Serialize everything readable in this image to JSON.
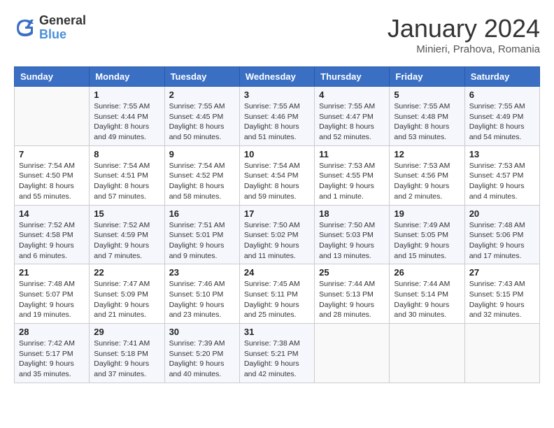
{
  "header": {
    "logo_general": "General",
    "logo_blue": "Blue",
    "title": "January 2024",
    "subtitle": "Minieri, Prahova, Romania"
  },
  "weekdays": [
    "Sunday",
    "Monday",
    "Tuesday",
    "Wednesday",
    "Thursday",
    "Friday",
    "Saturday"
  ],
  "weeks": [
    [
      {
        "day": "",
        "info": ""
      },
      {
        "day": "1",
        "info": "Sunrise: 7:55 AM\nSunset: 4:44 PM\nDaylight: 8 hours\nand 49 minutes."
      },
      {
        "day": "2",
        "info": "Sunrise: 7:55 AM\nSunset: 4:45 PM\nDaylight: 8 hours\nand 50 minutes."
      },
      {
        "day": "3",
        "info": "Sunrise: 7:55 AM\nSunset: 4:46 PM\nDaylight: 8 hours\nand 51 minutes."
      },
      {
        "day": "4",
        "info": "Sunrise: 7:55 AM\nSunset: 4:47 PM\nDaylight: 8 hours\nand 52 minutes."
      },
      {
        "day": "5",
        "info": "Sunrise: 7:55 AM\nSunset: 4:48 PM\nDaylight: 8 hours\nand 53 minutes."
      },
      {
        "day": "6",
        "info": "Sunrise: 7:55 AM\nSunset: 4:49 PM\nDaylight: 8 hours\nand 54 minutes."
      }
    ],
    [
      {
        "day": "7",
        "info": "Sunrise: 7:54 AM\nSunset: 4:50 PM\nDaylight: 8 hours\nand 55 minutes."
      },
      {
        "day": "8",
        "info": "Sunrise: 7:54 AM\nSunset: 4:51 PM\nDaylight: 8 hours\nand 57 minutes."
      },
      {
        "day": "9",
        "info": "Sunrise: 7:54 AM\nSunset: 4:52 PM\nDaylight: 8 hours\nand 58 minutes."
      },
      {
        "day": "10",
        "info": "Sunrise: 7:54 AM\nSunset: 4:54 PM\nDaylight: 8 hours\nand 59 minutes."
      },
      {
        "day": "11",
        "info": "Sunrise: 7:53 AM\nSunset: 4:55 PM\nDaylight: 9 hours\nand 1 minute."
      },
      {
        "day": "12",
        "info": "Sunrise: 7:53 AM\nSunset: 4:56 PM\nDaylight: 9 hours\nand 2 minutes."
      },
      {
        "day": "13",
        "info": "Sunrise: 7:53 AM\nSunset: 4:57 PM\nDaylight: 9 hours\nand 4 minutes."
      }
    ],
    [
      {
        "day": "14",
        "info": "Sunrise: 7:52 AM\nSunset: 4:58 PM\nDaylight: 9 hours\nand 6 minutes."
      },
      {
        "day": "15",
        "info": "Sunrise: 7:52 AM\nSunset: 4:59 PM\nDaylight: 9 hours\nand 7 minutes."
      },
      {
        "day": "16",
        "info": "Sunrise: 7:51 AM\nSunset: 5:01 PM\nDaylight: 9 hours\nand 9 minutes."
      },
      {
        "day": "17",
        "info": "Sunrise: 7:50 AM\nSunset: 5:02 PM\nDaylight: 9 hours\nand 11 minutes."
      },
      {
        "day": "18",
        "info": "Sunrise: 7:50 AM\nSunset: 5:03 PM\nDaylight: 9 hours\nand 13 minutes."
      },
      {
        "day": "19",
        "info": "Sunrise: 7:49 AM\nSunset: 5:05 PM\nDaylight: 9 hours\nand 15 minutes."
      },
      {
        "day": "20",
        "info": "Sunrise: 7:48 AM\nSunset: 5:06 PM\nDaylight: 9 hours\nand 17 minutes."
      }
    ],
    [
      {
        "day": "21",
        "info": "Sunrise: 7:48 AM\nSunset: 5:07 PM\nDaylight: 9 hours\nand 19 minutes."
      },
      {
        "day": "22",
        "info": "Sunrise: 7:47 AM\nSunset: 5:09 PM\nDaylight: 9 hours\nand 21 minutes."
      },
      {
        "day": "23",
        "info": "Sunrise: 7:46 AM\nSunset: 5:10 PM\nDaylight: 9 hours\nand 23 minutes."
      },
      {
        "day": "24",
        "info": "Sunrise: 7:45 AM\nSunset: 5:11 PM\nDaylight: 9 hours\nand 25 minutes."
      },
      {
        "day": "25",
        "info": "Sunrise: 7:44 AM\nSunset: 5:13 PM\nDaylight: 9 hours\nand 28 minutes."
      },
      {
        "day": "26",
        "info": "Sunrise: 7:44 AM\nSunset: 5:14 PM\nDaylight: 9 hours\nand 30 minutes."
      },
      {
        "day": "27",
        "info": "Sunrise: 7:43 AM\nSunset: 5:15 PM\nDaylight: 9 hours\nand 32 minutes."
      }
    ],
    [
      {
        "day": "28",
        "info": "Sunrise: 7:42 AM\nSunset: 5:17 PM\nDaylight: 9 hours\nand 35 minutes."
      },
      {
        "day": "29",
        "info": "Sunrise: 7:41 AM\nSunset: 5:18 PM\nDaylight: 9 hours\nand 37 minutes."
      },
      {
        "day": "30",
        "info": "Sunrise: 7:39 AM\nSunset: 5:20 PM\nDaylight: 9 hours\nand 40 minutes."
      },
      {
        "day": "31",
        "info": "Sunrise: 7:38 AM\nSunset: 5:21 PM\nDaylight: 9 hours\nand 42 minutes."
      },
      {
        "day": "",
        "info": ""
      },
      {
        "day": "",
        "info": ""
      },
      {
        "day": "",
        "info": ""
      }
    ]
  ]
}
